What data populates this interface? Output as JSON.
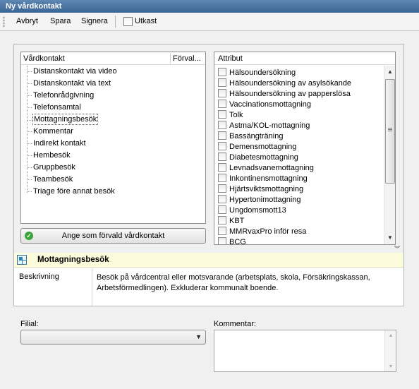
{
  "window": {
    "title": "Ny vårdkontakt"
  },
  "toolbar": {
    "cancel": "Avbryt",
    "save": "Spara",
    "sign": "Signera",
    "draft_label": "Utkast"
  },
  "contact_list": {
    "col_contact": "Vårdkontakt",
    "col_default": "Förval...",
    "items": [
      "Distanskontakt via video",
      "Distanskontakt via text",
      "Telefonrådgivning",
      "Telefonsamtal",
      "Mottagningsbesök",
      "Kommentar",
      "Indirekt kontakt",
      "Hembesök",
      "Gruppbesök",
      "Teambesök",
      "Triage före annat besök"
    ],
    "selected_index": 4
  },
  "default_button": {
    "label": "Ange som förvald vårdkontakt"
  },
  "attributes": {
    "header": "Attribut",
    "items": [
      "Hälsoundersökning",
      "Hälsoundersökning av asylsökande",
      "Hälsoundersökning av papperslösa",
      "Vaccinationsmottagning",
      "Tolk",
      "Astma/KOL-mottagning",
      "Bassängträning",
      "Demensmottagning",
      "Diabetesmottagning",
      "Levnadsvanemottagning",
      "Inkontinensmottagning",
      "Hjärtsviktsmottagning",
      "Hypertonimottagning",
      "Ungdomsmott13",
      "KBT",
      "MMRvaxPro inför resa",
      "BCG"
    ]
  },
  "info": {
    "title": "Mottagningsbesök",
    "description_label": "Beskrivning",
    "description": "Besök på vårdcentral eller motsvarande (arbetsplats, skola, Försäkringskassan, Arbetsförmedlingen). Exkluderar kommunalt boende."
  },
  "form": {
    "filial_label": "Filial:",
    "filial_value": "",
    "comment_label": "Kommentar:",
    "comment_value": ""
  }
}
